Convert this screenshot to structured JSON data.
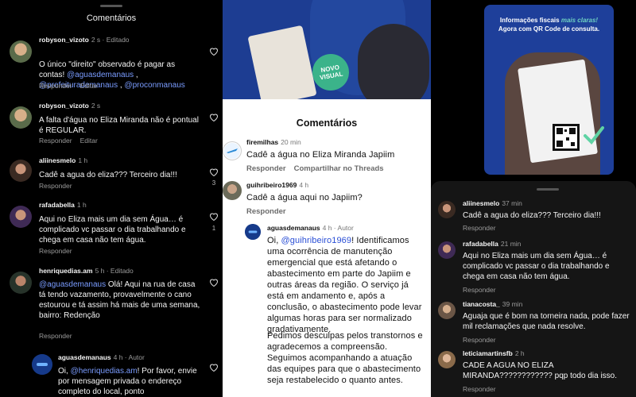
{
  "panel1": {
    "title": "Comentários",
    "comments": [
      {
        "user": "robyson_vizoto",
        "time": "2 s · Editado",
        "text_plain": "O único \"direito\" observado é pagar as contas! ",
        "mentions": [
          "@aguasdemanaus",
          "@prefeiturademanaus",
          "@proconmanaus"
        ],
        "actions": [
          "Responder",
          "Editar"
        ]
      },
      {
        "user": "robyson_vizoto",
        "time": "2 s",
        "text": "A falta d'água no Eliza Miranda não é pontual é REGULAR.",
        "actions": [
          "Responder",
          "Editar"
        ]
      },
      {
        "user": "aliinesmelo",
        "time": "1 h",
        "text": "Cadê a agua do eliza??? Terceiro dia!!!",
        "actions": [
          "Responder"
        ],
        "likes": "3"
      },
      {
        "user": "rafadabella",
        "time": "1 h",
        "text": "Aqui no Eliza mais um dia sem Água… é complicado vc passar o dia trabalhando e chega em casa não tem água.",
        "actions": [
          "Responder"
        ],
        "likes": "1"
      },
      {
        "user": "henriquedias.am",
        "time": "5 h · Editado",
        "mention": "@aguasdemanaus",
        "text": " Olá! Aqui na rua de casa tá tendo vazamento, provavelmente o cano estourou e tá assim há mais de uma semana, bairro: Redenção",
        "actions": [
          "Responder"
        ]
      },
      {
        "user": "aguasdemanaus",
        "time": "4 h · Autor",
        "text_a": "Oi, ",
        "mention": "@henriquedias.am",
        "text_b": "! Por favor, envie por mensagem privada o endereço completo do local, ponto"
      }
    ]
  },
  "panel2": {
    "badge": "NOVO VISUAL",
    "title": "Comentários",
    "comments": [
      {
        "user": "firemilhas",
        "time": "20 min",
        "text": "Cadê a água no Eliza Miranda Japiim",
        "actions": [
          "Responder",
          "Compartilhar no Threads"
        ]
      },
      {
        "user": "guihribeiro1969",
        "time": "4 h",
        "text": "Cadê a água aqui no Japiim?",
        "actions": [
          "Responder"
        ]
      },
      {
        "user": "aguasdemanaus",
        "time": "4 h · Autor",
        "text_a": "Oi, ",
        "mention": "@guihribeiro1969",
        "text_b": "! Identificamos uma ocorrência de manutenção emergencial que está afetando o abastecimento em parte do Japiim e outras áreas da região. O serviço já está em andamento e, após a conclusão, o abastecimento pode levar algumas horas para ser normalizado gradativamente.",
        "text_c": "Pedimos desculpas pelos transtornos e agradecemos a compreensão. Seguimos acompanhando a atuação das equipes para que o abastecimento seja restabelecido o quanto antes."
      }
    ]
  },
  "panel3": {
    "promo_line1_a": "Informações fiscais ",
    "promo_line1_b": "mais claras!",
    "promo_line2": "Agora com QR Code de consulta.",
    "comments": [
      {
        "user": "aliinesmelo",
        "time": "37 min",
        "text": "Cadê a agua do eliza??? Terceiro dia!!!",
        "actions": [
          "Responder"
        ]
      },
      {
        "user": "rafadabella",
        "time": "21 min",
        "text": "Aqui no Eliza mais um dia sem Água… é complicado vc passar o dia trabalhando e chega em casa não tem água.",
        "actions": [
          "Responder"
        ]
      },
      {
        "user": "tianacosta_",
        "time": "39 min",
        "text": "Aguaja que é bom na torneira nada, pode fazer mil reclamações que nada resolve.",
        "actions": [
          "Responder"
        ]
      },
      {
        "user": "leticiamartinsfb",
        "time": "2 h",
        "text": "CADE A AGUA NO ELIZA MIRANDA???????????? pqp todo dia isso.",
        "actions": [
          "Responder"
        ]
      }
    ]
  },
  "colors": {
    "mention_dark": "#7a9cff",
    "mention_light": "#2a4fd6",
    "brand_blue": "#1e3f9a",
    "badge_green": "#3bb38a"
  }
}
